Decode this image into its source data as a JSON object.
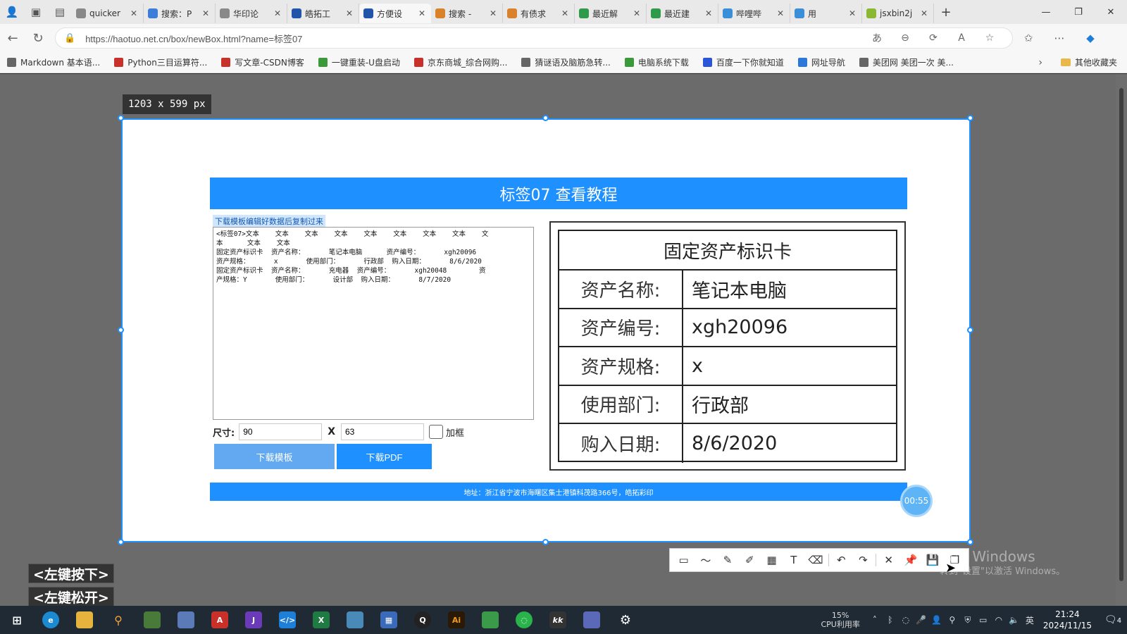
{
  "browser": {
    "tabs": [
      {
        "label": "quicker",
        "favicon_color": "#888888",
        "active": false
      },
      {
        "label": "搜索：P",
        "favicon_color": "#3b7dd8",
        "active": false
      },
      {
        "label": "华印论",
        "favicon_color": "#888888",
        "active": false
      },
      {
        "label": "皓拓工",
        "favicon_color": "#2255aa",
        "active": false
      },
      {
        "label": "方便设",
        "favicon_color": "#2255aa",
        "active": true
      },
      {
        "label": "搜索 - ",
        "favicon_color": "#d9822b",
        "active": false
      },
      {
        "label": "有债求",
        "favicon_color": "#d9822b",
        "active": false
      },
      {
        "label": "最近解",
        "favicon_color": "#2e9a4a",
        "active": false
      },
      {
        "label": "最近建",
        "favicon_color": "#2e9a4a",
        "active": false
      },
      {
        "label": "哔哩哔",
        "favicon_color": "#3b8ed8",
        "active": false
      },
      {
        "label": "用",
        "favicon_color": "#3b8ed8",
        "active": false
      },
      {
        "label": "jsxbin2j",
        "favicon_color": "#8ab832",
        "active": false
      }
    ],
    "url": "https://haotuo.net.cn/box/newBox.html?name=标签07",
    "bookmarks": [
      {
        "label": "Markdown 基本语...",
        "icon_color": "#666666"
      },
      {
        "label": "Python三目运算符...",
        "icon_color": "#c8302a"
      },
      {
        "label": "写文章-CSDN博客",
        "icon_color": "#c8302a"
      },
      {
        "label": "一键重装-U盘启动",
        "icon_color": "#3a9a3a"
      },
      {
        "label": "京东商城_综合网购...",
        "icon_color": "#c8302a"
      },
      {
        "label": "猜谜语及脑筋急转...",
        "icon_color": "#666666"
      },
      {
        "label": "电脑系统下载",
        "icon_color": "#3a9a3a"
      },
      {
        "label": "百度一下你就知道",
        "icon_color": "#2b55d8"
      },
      {
        "label": "网址导航",
        "icon_color": "#2b78d8"
      },
      {
        "label": "美团网 美团一次 美...",
        "icon_color": "#666666"
      }
    ],
    "other_bookmarks": "其他收藏夹"
  },
  "capture": {
    "size_label": "1203 x 599  px"
  },
  "site": {
    "header_title": "标签07 查看教程",
    "hint": "下载模板编辑好数据后复制过来",
    "textarea_value": "<标签07>文本    文本    文本    文本    文本    文本    文本    文本    文\n本      文本    文本\n固定资产标识卡  资产名称：      笔记本电脑      资产编号：      xgh20096\n资产规格：      x       使用部门：      行政部  购入日期：      8/6/2020\n固定资产标识卡  资产名称：      充电器  资产编号：      xgh20048        资\n产规格：Y       使用部门：      设计部  购入日期：      8/7/2020",
    "size_label": "尺寸:",
    "width_value": "90",
    "x_label": "X",
    "height_value": "63",
    "border_label": "加框",
    "btn_template": "下载模板",
    "btn_pdf": "下载PDF",
    "footer": "地址：浙江省宁波市海曙区集士港镇科茂路366号，皓拓彩印",
    "timer": "00:55"
  },
  "card": {
    "title": "固定资产标识卡",
    "rows": [
      {
        "key": "资产名称:",
        "value": "笔记本电脑"
      },
      {
        "key": "资产编号:",
        "value": "xgh20096"
      },
      {
        "key": "资产规格:",
        "value": "x"
      },
      {
        "key": "使用部门:",
        "value": "行政部"
      },
      {
        "key": "购入日期:",
        "value": "8/6/2020"
      }
    ]
  },
  "overlay": {
    "watermark_title": "激活 Windows",
    "watermark_sub": "转到\"设置\"以激活 Windows。",
    "key_down": "<左键按下>",
    "key_up": "<左键松开>"
  },
  "taskbar": {
    "cpu_percent": "15%",
    "cpu_label": "CPU利用率",
    "ime": "英",
    "time": "21:24",
    "date": "2024/11/15",
    "notif_count": "4"
  }
}
